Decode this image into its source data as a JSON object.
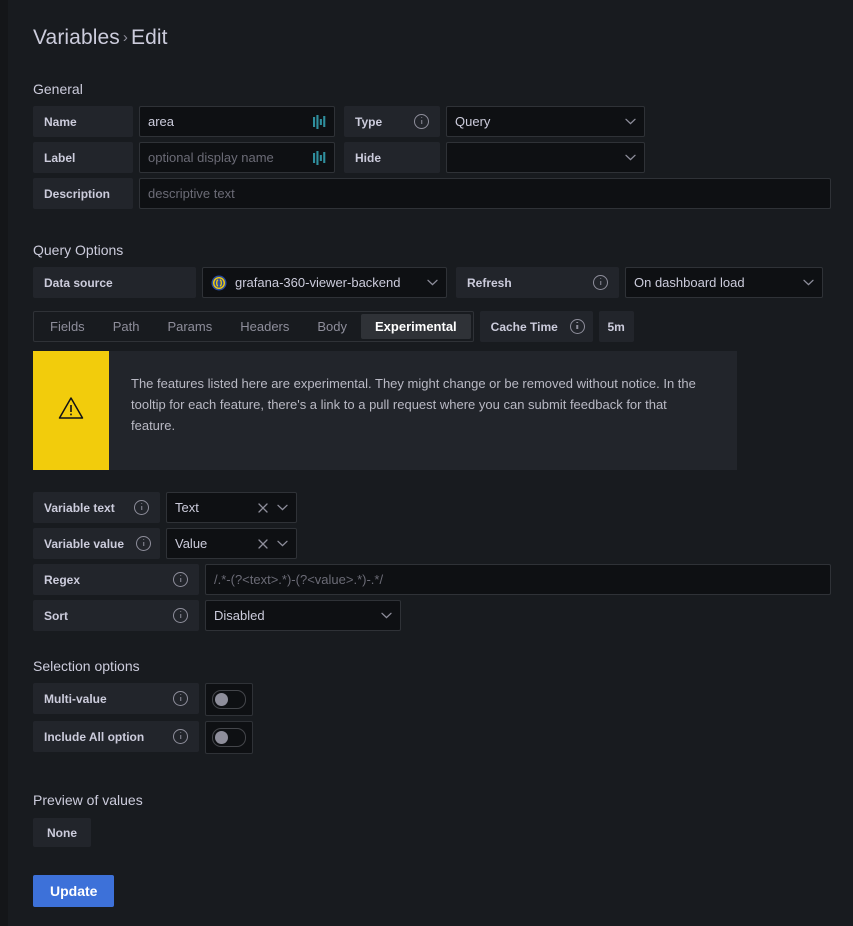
{
  "breadcrumb": {
    "root": "Variables",
    "separator": "›",
    "current": "Edit"
  },
  "general": {
    "section_title": "General",
    "name": {
      "label": "Name",
      "value": "area",
      "icon": "bars-icon"
    },
    "type": {
      "label": "Type",
      "info_icon": "info-icon",
      "value": "Query",
      "chevron": "chevron-down-icon"
    },
    "label_field": {
      "label": "Label",
      "placeholder": "optional display name",
      "value": "",
      "icon": "bars-icon"
    },
    "hide": {
      "label": "Hide",
      "value": "",
      "chevron": "chevron-down-icon"
    },
    "description": {
      "label": "Description",
      "placeholder": "descriptive text",
      "value": ""
    }
  },
  "query_options": {
    "section_title": "Query Options",
    "data_source": {
      "label": "Data source",
      "value": "grafana-360-viewer-backend",
      "icon": "json-api-datasource-icon",
      "chevron": "chevron-down-icon"
    },
    "refresh": {
      "label": "Refresh",
      "info_icon": "info-icon",
      "value": "On dashboard load",
      "chevron": "chevron-down-icon"
    },
    "tabs": [
      {
        "label": "Fields",
        "active": false
      },
      {
        "label": "Path",
        "active": false
      },
      {
        "label": "Params",
        "active": false
      },
      {
        "label": "Headers",
        "active": false
      },
      {
        "label": "Body",
        "active": false
      },
      {
        "label": "Experimental",
        "active": true
      }
    ],
    "cache_time": {
      "label": "Cache Time",
      "info_icon": "info-icon",
      "value": "5m"
    },
    "warning": {
      "icon": "warning-triangle-icon",
      "text": "The features listed here are experimental. They might change or be removed without notice. In the tooltip for each feature, there's a link to a pull request where you can submit feedback for that feature."
    },
    "variable_text": {
      "label": "Variable text",
      "info_icon": "info-icon",
      "value": "Text",
      "clear_icon": "close-icon",
      "chevron": "chevron-down-icon"
    },
    "variable_value": {
      "label": "Variable value",
      "info_icon": "info-icon",
      "value": "Value",
      "clear_icon": "close-icon",
      "chevron": "chevron-down-icon"
    },
    "regex": {
      "label": "Regex",
      "info_icon": "info-icon",
      "placeholder": "/.*-(?<text>.*)-(?<value>.*)-.*/",
      "value": ""
    },
    "sort": {
      "label": "Sort",
      "info_icon": "info-icon",
      "value": "Disabled",
      "chevron": "chevron-down-icon"
    }
  },
  "selection_options": {
    "section_title": "Selection options",
    "multi_value": {
      "label": "Multi-value",
      "info_icon": "info-icon",
      "enabled": false
    },
    "include_all": {
      "label": "Include All option",
      "info_icon": "info-icon",
      "enabled": false
    }
  },
  "preview": {
    "section_title": "Preview of values",
    "values": [
      "None"
    ]
  },
  "actions": {
    "update_label": "Update"
  },
  "colors": {
    "accent_button": "#3d71d9",
    "warning": "#f2cc0c",
    "field_icon": "#2f8f9e",
    "page_bg": "#181b1f",
    "input_bg": "#0e1013",
    "label_bg": "#22252b"
  }
}
